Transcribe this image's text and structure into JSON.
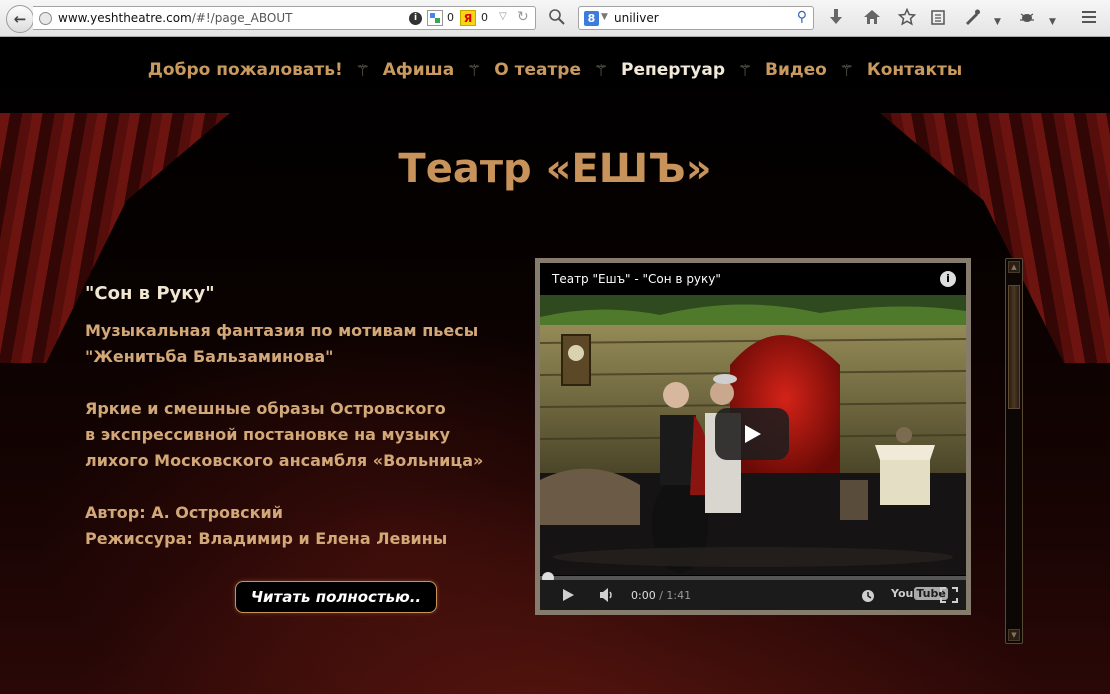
{
  "browser": {
    "url_domain": "www.yeshtheatre.com",
    "url_path": "/#!/page_ABOUT",
    "ext_google_count": "0",
    "ext_yandex_label": "Я",
    "ext_yandex_count": "0",
    "search_engine_label": "8",
    "search_query": "uniliver"
  },
  "nav": {
    "items": [
      {
        "label": "Добро пожаловать!"
      },
      {
        "label": "Афиша"
      },
      {
        "label": "О театре"
      },
      {
        "label": "Репертуар"
      },
      {
        "label": "Видео"
      },
      {
        "label": "Контакты"
      }
    ],
    "active": "Репертуар"
  },
  "page": {
    "title": "Театр «ЕШЪ»"
  },
  "article": {
    "show_title": "\"Сон в Руку\"",
    "subtitle_line1": "Музыкальная фантазия по мотивам пьесы",
    "subtitle_line2": "\"Женитьба Бальзаминова\"",
    "desc_line1": "Яркие и смешные образы Островского",
    "desc_line2": "в экспрессивной постановке на музыку",
    "desc_line3": "лихого Московского ансамбля «Вольница»",
    "author": "Автор: А. Островский",
    "director": "Режиссура: Владимир и Елена Левины",
    "read_more": "Читать полностью.."
  },
  "video": {
    "title": "Театр \"Ешъ\" - \"Сон в руку\"",
    "current_time": "0:00",
    "time_separator": "/",
    "duration": "1:41",
    "logo_you": "You",
    "logo_tube": "Tube",
    "progress": 0
  },
  "colors": {
    "nav_link": "#c99a5f",
    "nav_active": "#f2ead8",
    "title": "#c8935b",
    "body_text": "#d2a878"
  }
}
